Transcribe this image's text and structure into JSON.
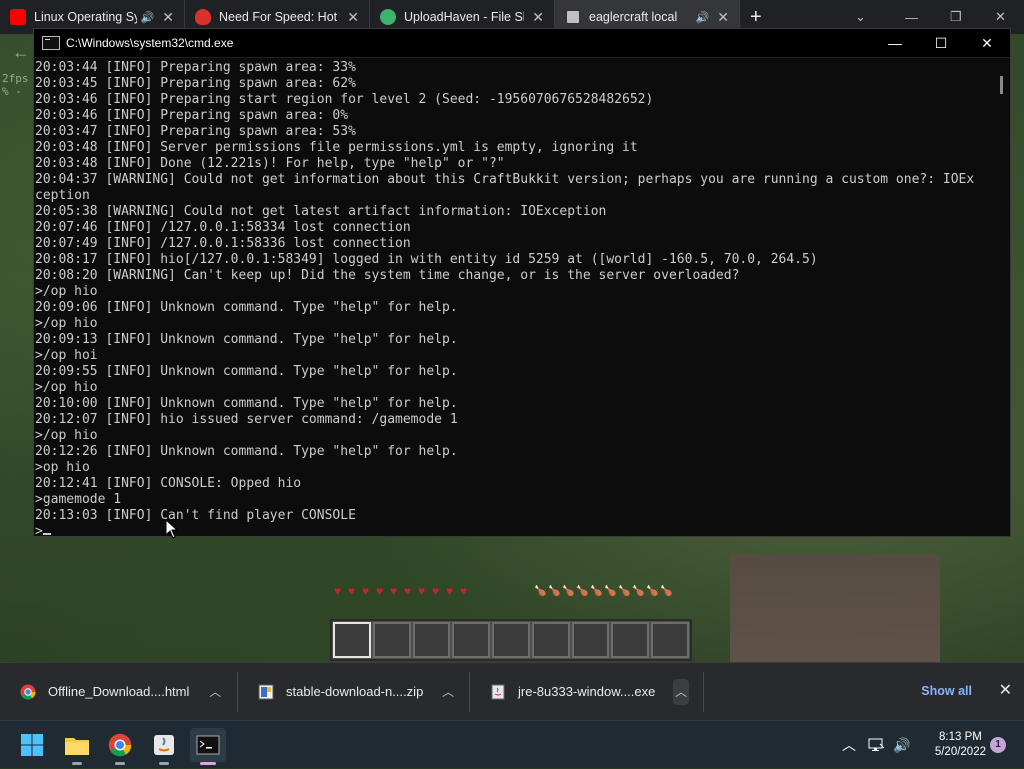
{
  "browser": {
    "tabs": [
      {
        "title": "Linux Operating Sy",
        "audio": true,
        "favicon_color": "#ff0000",
        "active": false
      },
      {
        "title": "Need For Speed: Hot P",
        "audio": false,
        "favicon_color": "#d9312b",
        "active": false
      },
      {
        "title": "UploadHaven - File Sh",
        "audio": false,
        "favicon_color": "#3cb371",
        "active": false
      },
      {
        "title": "eaglercraft local",
        "audio": true,
        "favicon_color": "#c0c0c0",
        "active": true
      }
    ],
    "new_tab_label": "+"
  },
  "game": {
    "fps_text": "2fps",
    "fps_sub": "% -",
    "hearts": 10,
    "hunger": 10,
    "hotbar_slots": 9,
    "selected_slot": 1
  },
  "cmd": {
    "title": "C:\\Windows\\system32\\cmd.exe",
    "lines": [
      "20:03:44 [INFO] Preparing spawn area: 33%",
      "20:03:45 [INFO] Preparing spawn area: 62%",
      "20:03:46 [INFO] Preparing start region for level 2 (Seed: -1956070676528482652)",
      "20:03:46 [INFO] Preparing spawn area: 0%",
      "20:03:47 [INFO] Preparing spawn area: 53%",
      "20:03:48 [INFO] Server permissions file permissions.yml is empty, ignoring it",
      "20:03:48 [INFO] Done (12.221s)! For help, type \"help\" or \"?\"",
      "20:04:37 [WARNING] Could not get information about this CraftBukkit version; perhaps you are running a custom one?: IOEx",
      "ception",
      "20:05:38 [WARNING] Could not get latest artifact information: IOException",
      "20:07:46 [INFO] /127.0.0.1:58334 lost connection",
      "20:07:49 [INFO] /127.0.0.1:58336 lost connection",
      "20:08:17 [INFO] hio[/127.0.0.1:58349] logged in with entity id 5259 at ([world] -160.5, 70.0, 264.5)",
      "20:08:20 [WARNING] Can't keep up! Did the system time change, or is the server overloaded?",
      ">/op hio",
      "20:09:06 [INFO] Unknown command. Type \"help\" for help.",
      ">/op hio",
      "20:09:13 [INFO] Unknown command. Type \"help\" for help.",
      ">/op hoi",
      "20:09:55 [INFO] Unknown command. Type \"help\" for help.",
      ">/op hio",
      "20:10:00 [INFO] Unknown command. Type \"help\" for help.",
      "20:12:07 [INFO] hio issued server command: /gamemode 1",
      ">/op hio",
      "20:12:26 [INFO] Unknown command. Type \"help\" for help.",
      ">op hio",
      "20:12:41 [INFO] CONSOLE: Opped hio",
      ">gamemode 1",
      "20:13:03 [INFO] Can't find player CONSOLE"
    ],
    "prompt": ">",
    "minimize": "—",
    "maximize": "☐",
    "close": "✕"
  },
  "downloads": {
    "items": [
      {
        "name": "Offline_Download....html",
        "icon": "chrome-icon"
      },
      {
        "name": "stable-download-n....zip",
        "icon": "zip-icon"
      },
      {
        "name": "jre-8u333-window....exe",
        "icon": "java-installer-icon"
      }
    ],
    "show_all": "Show all",
    "close": "✕"
  },
  "taskbar": {
    "apps": [
      "start-icon",
      "file-explorer-icon",
      "chrome-icon",
      "java-icon",
      "cmd-icon"
    ],
    "time": "8:13 PM",
    "date": "5/20/2022",
    "notifications": "1"
  }
}
